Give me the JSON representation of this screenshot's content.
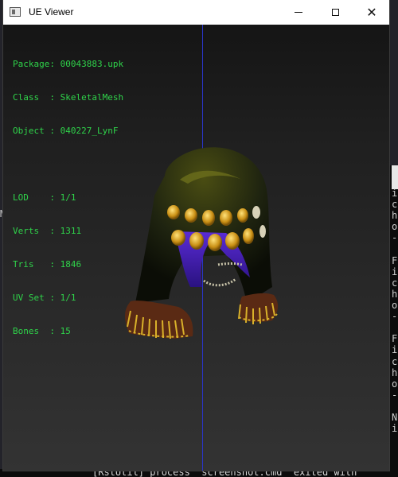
{
  "window": {
    "title": "UE Viewer",
    "minimize_label": "—",
    "maximize_label": "☐",
    "close_label": "✕"
  },
  "info": {
    "package_label": "Package: ",
    "package": "00043883.upk",
    "class_label": "Class  : ",
    "class": "SkeletalMesh",
    "object_label": "Object : ",
    "object": "040227_LynF",
    "lod_label": "LOD    : ",
    "lod": "1/1",
    "verts_label": "Verts  : ",
    "verts": "1311",
    "tris_label": "Tris   : ",
    "tris": "1846",
    "uvset_label": "UV Set : ",
    "uvset": "1/1",
    "bones_label": "Bones  : ",
    "bones": "15"
  },
  "background": {
    "left_char": "M",
    "right_chars": [
      "i",
      "c",
      "h",
      "o",
      "-",
      "",
      "F",
      "i",
      "c",
      "h",
      "o",
      "-",
      "",
      "F",
      "i",
      "c",
      "h",
      "o",
      "-",
      "",
      "N",
      "i"
    ],
    "bottom_text": "[RstUtil] process \"screenshot.cmd\" exited with"
  },
  "colors": {
    "info_text": "#2fd34a",
    "axis": "#2a35c8",
    "titlebar": "#ffffff"
  }
}
